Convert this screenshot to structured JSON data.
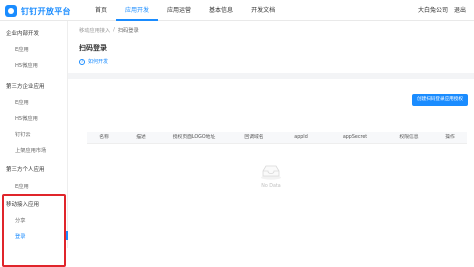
{
  "app": {
    "logo_text": "钉钉开放平台"
  },
  "nav": {
    "items": [
      {
        "label": "首页"
      },
      {
        "label": "应用开发"
      },
      {
        "label": "应用运营"
      },
      {
        "label": "基本信息"
      },
      {
        "label": "开发文档"
      }
    ],
    "active_index": 1
  },
  "user": {
    "company": "大白兔公司",
    "logout": "退出"
  },
  "sidebar": {
    "groups": [
      {
        "title": "企业内部开发",
        "items": [
          "E应用",
          "H5微应用"
        ]
      },
      {
        "title": "第三方企业应用",
        "items": [
          "E应用",
          "H5微应用",
          "钉钉云",
          "上架应用市场"
        ]
      },
      {
        "title": "第三方个人应用",
        "items": [
          "E应用"
        ]
      },
      {
        "title": "移动接入应用",
        "items": [
          "分享",
          "登录"
        ]
      }
    ],
    "active_item": "登录"
  },
  "breadcrumb": {
    "parent": "移动应用接入",
    "separator": "/",
    "current": "扫码登录"
  },
  "page": {
    "title": "扫码登录",
    "help_label": "如何开发",
    "create_button": "创建扫码登录应用授权"
  },
  "table": {
    "columns": [
      "名称",
      "描述",
      "授权页面LOGO地址",
      "回调域名",
      "appId",
      "appSecret",
      "权限信息",
      "操作"
    ],
    "rows": [],
    "empty_text": "No Data"
  },
  "colors": {
    "accent": "#1a8cff",
    "highlight_border": "#e0252b"
  }
}
